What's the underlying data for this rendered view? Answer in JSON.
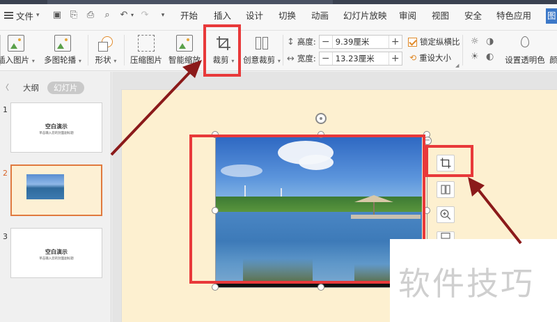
{
  "menu": {
    "file_label": "文件",
    "tabs": [
      "开始",
      "插入",
      "设计",
      "切换",
      "动画",
      "幻灯片放映",
      "审阅",
      "视图",
      "安全",
      "特色应用",
      "图"
    ],
    "active_tab": "插入"
  },
  "ribbon": {
    "insert_picture": "插入图片",
    "multi_picture": "多图轮播",
    "shape": "形状",
    "compress": "压缩图片",
    "smart_zoom": "智能缩放",
    "crop": "裁剪",
    "creative_crop": "创意裁剪",
    "height_label": "高度:",
    "height_value": "9.39厘米",
    "width_label": "宽度:",
    "width_value": "13.23厘米",
    "lock_ratio": "锁定纵横比",
    "reset_size": "重设大小",
    "set_transparent": "设置透明色",
    "partial_next": "颜"
  },
  "left_panel": {
    "tab_outline": "大纲",
    "tab_slides": "幻灯片",
    "slides": [
      {
        "num": "1",
        "title": "空白演示",
        "subtitle": "单击输入您的封面副标题"
      },
      {
        "num": "2"
      },
      {
        "num": "3",
        "title": "空白演示",
        "subtitle": "单击输入您的封面副标题"
      }
    ]
  },
  "watermark": "软件技巧",
  "colors": {
    "accent": "#e8393a",
    "arrow": "#8b1a1a",
    "slide_bg": "#fdf0d0"
  }
}
